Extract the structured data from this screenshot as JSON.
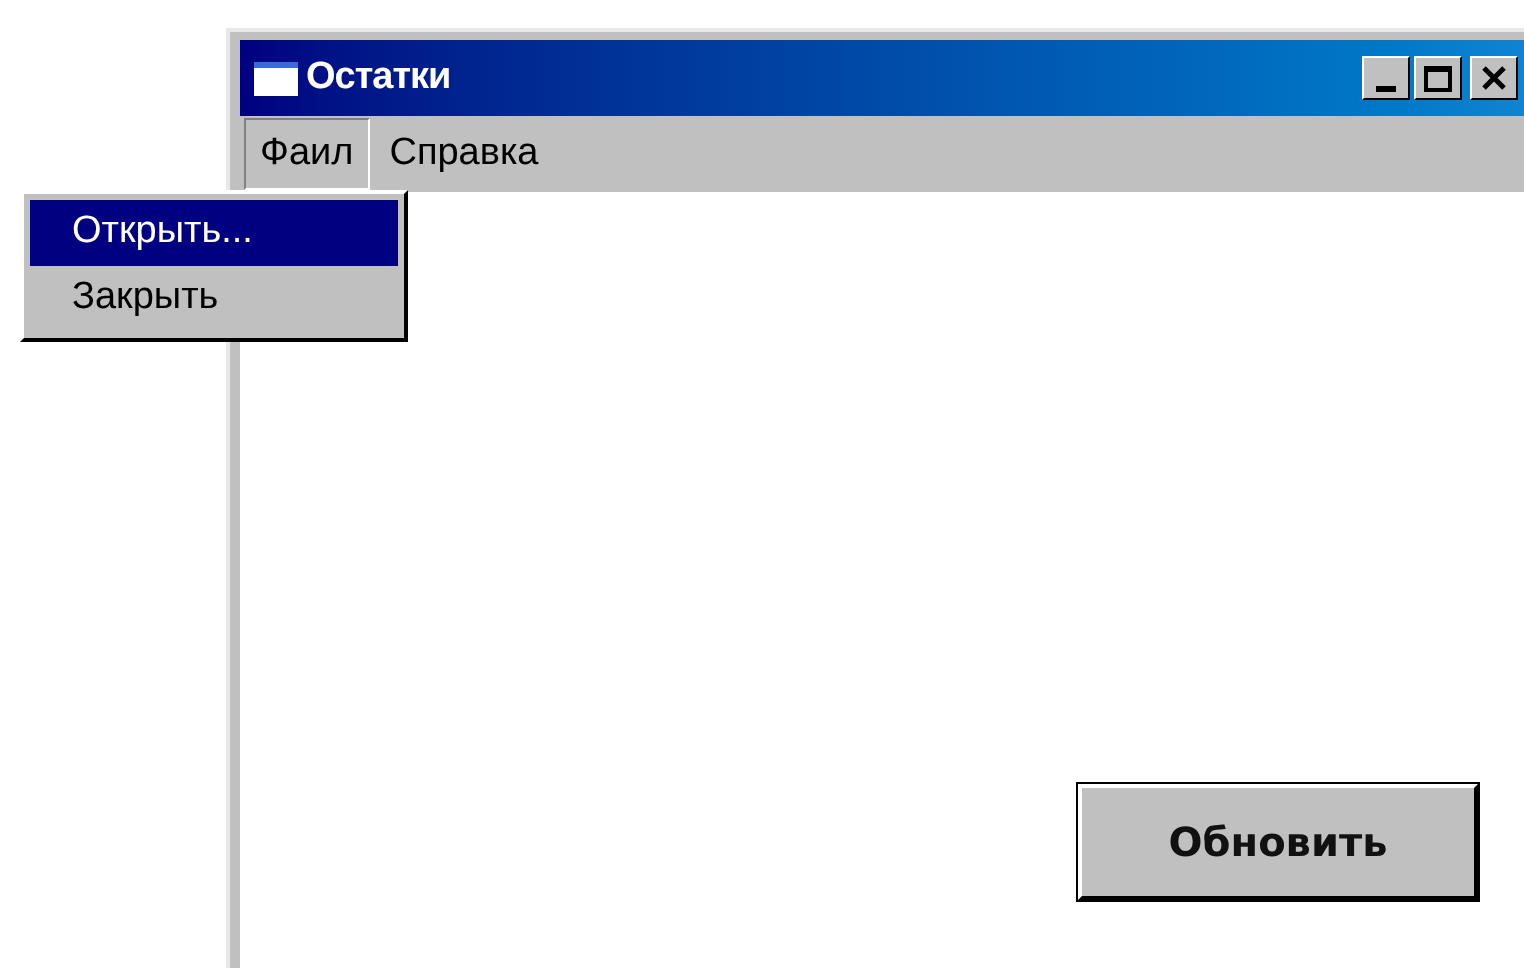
{
  "window": {
    "title": "Остатки"
  },
  "menu_bar": [
    {
      "label": "Фаил",
      "selected": true
    },
    {
      "label": "Справка",
      "selected": false
    }
  ],
  "dropdown": [
    {
      "label": "Открыть...",
      "selected": true
    },
    {
      "label": "Закрыть",
      "selected": false
    }
  ],
  "button": {
    "label": "Обновить"
  }
}
